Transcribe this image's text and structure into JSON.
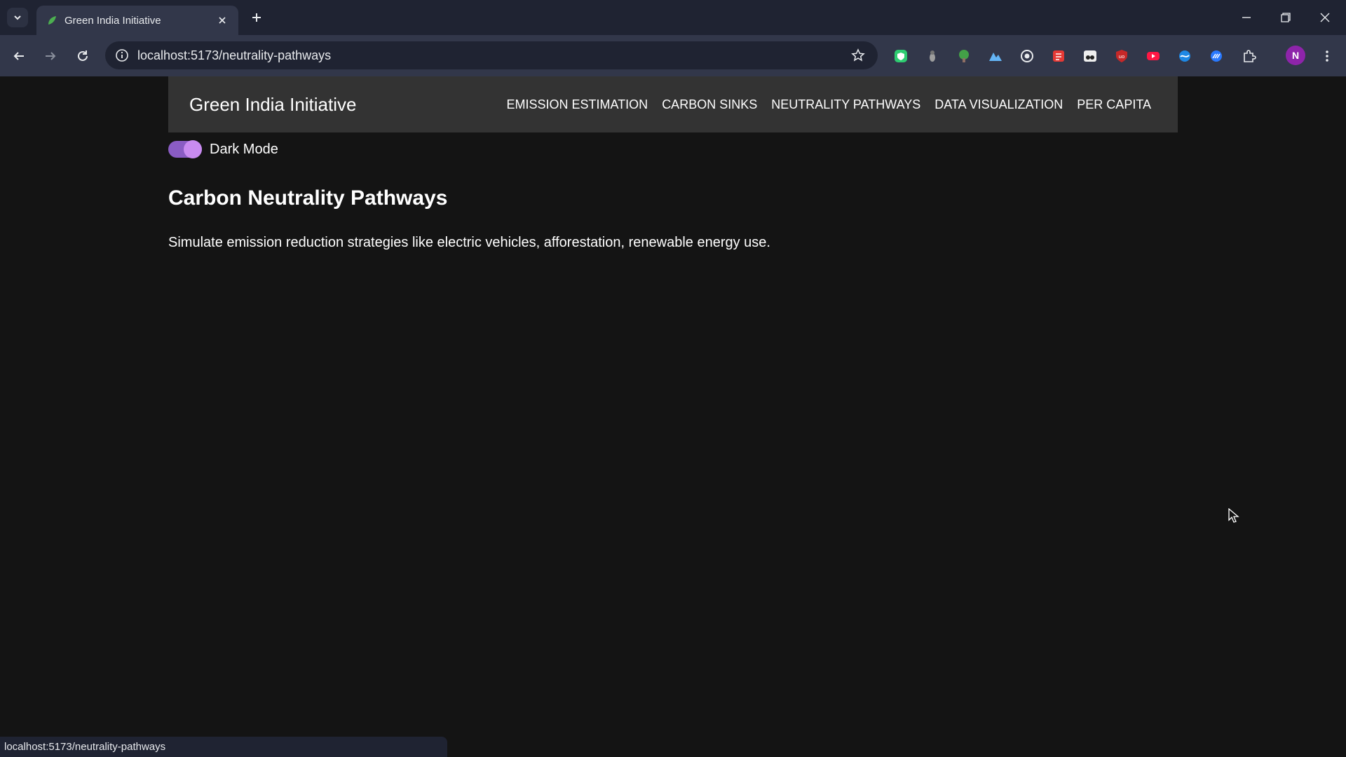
{
  "browser": {
    "tab_title": "Green India Initiative",
    "url": "localhost:5173/neutrality-pathways",
    "status_url": "localhost:5173/neutrality-pathways",
    "profile_initial": "N"
  },
  "navbar": {
    "brand": "Green India Initiative",
    "links": [
      "EMISSION ESTIMATION",
      "CARBON SINKS",
      "NEUTRALITY PATHWAYS",
      "DATA VISUALIZATION",
      "PER CAPITA"
    ]
  },
  "toggle": {
    "label": "Dark Mode",
    "on": true
  },
  "main": {
    "heading": "Carbon Neutrality Pathways",
    "description": "Simulate emission reduction strategies like electric vehicles, afforestation, renewable energy use."
  },
  "colors": {
    "page_background": "#141414",
    "navbar_background": "#333333",
    "toggle_track": "#8a5cc4",
    "toggle_knob": "#c98bf0"
  }
}
